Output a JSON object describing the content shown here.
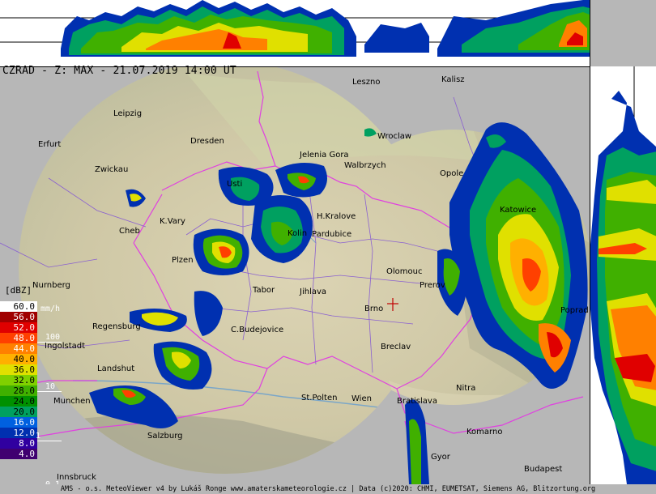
{
  "title": "CZRAD - Z: MAX - 21.07.2019 14:00 UT",
  "legend": {
    "unit": "[dBZ]",
    "rate_unit": "mm/h",
    "levels": [
      {
        "dbz": "60.0",
        "color": "#ffffff",
        "text": "#000000"
      },
      {
        "dbz": "56.0",
        "color": "#a00000",
        "text": "#ffffff"
      },
      {
        "dbz": "52.0",
        "color": "#e00000",
        "text": "#ffffff"
      },
      {
        "dbz": "48.0",
        "color": "#ff4000",
        "text": "#ffffff"
      },
      {
        "dbz": "44.0",
        "color": "#ff8000",
        "text": "#ffffff"
      },
      {
        "dbz": "40.0",
        "color": "#ffb000",
        "text": "#000000"
      },
      {
        "dbz": "36.0",
        "color": "#e0e000",
        "text": "#000000"
      },
      {
        "dbz": "32.0",
        "color": "#80d000",
        "text": "#000000"
      },
      {
        "dbz": "28.0",
        "color": "#40b000",
        "text": "#000000"
      },
      {
        "dbz": "24.0",
        "color": "#009000",
        "text": "#000000"
      },
      {
        "dbz": "20.0",
        "color": "#00a060",
        "text": "#000000"
      },
      {
        "dbz": "16.0",
        "color": "#0060e0",
        "text": "#ffffff"
      },
      {
        "dbz": "12.0",
        "color": "#0030b0",
        "text": "#ffffff"
      },
      {
        "dbz": "8.0",
        "color": "#3000a0",
        "text": "#ffffff"
      },
      {
        "dbz": "4.0",
        "color": "#400070",
        "text": "#ffffff"
      }
    ],
    "rates": [
      "100",
      "10",
      "1",
      "0.1"
    ]
  },
  "cities": [
    {
      "name": "Leszno"
    },
    {
      "name": "Kalisz"
    },
    {
      "name": "Leipzig"
    },
    {
      "name": "Wroclaw"
    },
    {
      "name": "Erfurt"
    },
    {
      "name": "Dresden"
    },
    {
      "name": "Jelenia Gora"
    },
    {
      "name": "Walbrzych"
    },
    {
      "name": "Zwickau"
    },
    {
      "name": "Opole"
    },
    {
      "name": "Usti"
    },
    {
      "name": "Katowice"
    },
    {
      "name": "K.Vary"
    },
    {
      "name": "H.Kralove"
    },
    {
      "name": "Cheb"
    },
    {
      "name": "Pardubice"
    },
    {
      "name": "Kolin"
    },
    {
      "name": "Plzen"
    },
    {
      "name": "Olomouc"
    },
    {
      "name": "Nurnberg"
    },
    {
      "name": "Tabor"
    },
    {
      "name": "Jihlava"
    },
    {
      "name": "Prerov"
    },
    {
      "name": "Brno"
    },
    {
      "name": "Poprad"
    },
    {
      "name": "Regensburg"
    },
    {
      "name": "C.Budejovice"
    },
    {
      "name": "Ingolstadt"
    },
    {
      "name": "Breclav"
    },
    {
      "name": "Landshut"
    },
    {
      "name": "Nitra"
    },
    {
      "name": "St.Polten"
    },
    {
      "name": "Wien"
    },
    {
      "name": "Munchen"
    },
    {
      "name": "Bratislava"
    },
    {
      "name": "Salzburg"
    },
    {
      "name": "Komarno"
    },
    {
      "name": "Gyor"
    },
    {
      "name": "Budapest"
    },
    {
      "name": "Innsbruck"
    }
  ],
  "footer": "AMS - o.s. MeteoViewer v4 by Lukáš Ronge www.amaterskameteorologie.cz | Data (c)2020: CHMI, EUMETSAT, Siemens AG, Blitzortung.org",
  "colors": {
    "background": "#b7b7b7",
    "border": "#e040e0",
    "terrain": "#d8d0b0"
  }
}
